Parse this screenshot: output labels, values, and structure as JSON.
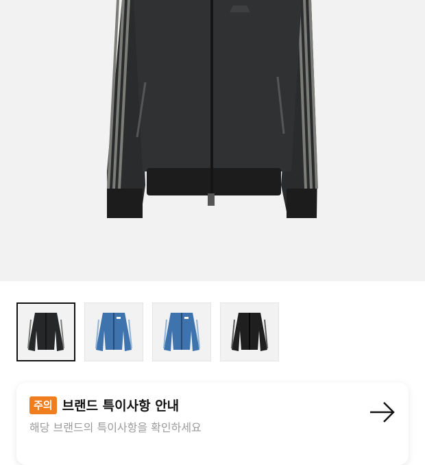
{
  "product_gallery": {
    "main_image": {
      "icon": "track-jacket-image",
      "color": "#2a2b2d",
      "stripe_color": "#7c7c78"
    },
    "thumbnails": [
      {
        "icon": "black-denim-jacket-thumbnail",
        "color": "#262728",
        "selected": true
      },
      {
        "icon": "blue-jacket-thumbnail",
        "color": "#3f73ad",
        "selected": false
      },
      {
        "icon": "blue-jacket-thumbnail",
        "color": "#3f73ad",
        "selected": false
      },
      {
        "icon": "black-jacket-thumbnail",
        "color": "#1f1f20",
        "selected": false
      }
    ]
  },
  "brand_notice": {
    "badge": "주의",
    "title": "브랜드 특이사항 안내",
    "subtitle": "해당 브랜드의 특이사항을 확인하세요",
    "badge_color": "#f07d1e",
    "icon": "arrow-right-icon"
  }
}
